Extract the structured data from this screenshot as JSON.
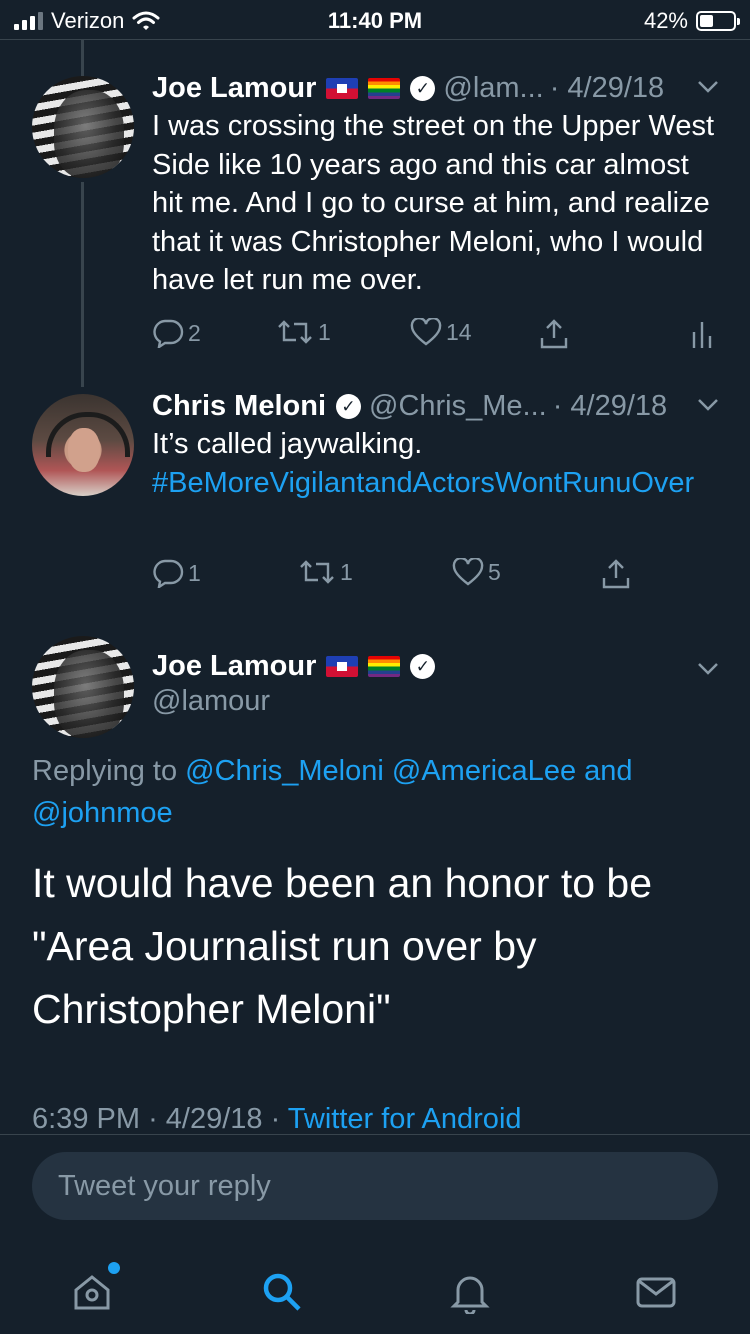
{
  "status_bar": {
    "carrier": "Verizon",
    "time": "11:40 PM",
    "battery_percent": "42%",
    "battery_level": 0.42,
    "signal_bars_on": 3,
    "signal_bars_total": 4
  },
  "tweet1": {
    "name": "Joe Lamour",
    "handle": "@lam...",
    "date": "· 4/29/18",
    "text": "I was crossing the street on the Upper West Side like 10 years ago and this car almost hit me. And I go to curse at him, and realize that it was Christopher Meloni, who I would have let run me over.",
    "replies": "2",
    "retweets": "1",
    "likes": "14"
  },
  "tweet2": {
    "name": "Chris Meloni",
    "handle": "@Chris_Me...",
    "date": "· 4/29/18",
    "text": "It’s called jaywalking.",
    "hashtag": "#BeMoreVigilantandActorsWontRunuOver",
    "replies": "1",
    "retweets": "1",
    "likes": "5"
  },
  "main_tweet": {
    "name": "Joe Lamour",
    "handle": "@lamour",
    "replying_prefix": "Replying to",
    "reply_mention_1": "@Chris_Meloni",
    "reply_mention_2": "@AmericaLee",
    "reply_and": "and",
    "reply_mention_3": "@johnmoe",
    "text": "It would have been an honor to be \"Area Journalist run over by Christopher Meloni\"",
    "time": "6:39 PM",
    "date": "· 4/29/18 ·",
    "source": "Twitter for Android"
  },
  "reply_box": {
    "placeholder": "Tweet your reply"
  },
  "tabbar": {
    "tabs": [
      "home-icon",
      "search-icon",
      "notifications-icon",
      "messages-icon"
    ],
    "active_tab": "search-icon",
    "accent_color": "#1da1f2"
  },
  "colors": {
    "background": "#15202b",
    "secondary_text": "#8899a6",
    "link": "#1da1f2"
  }
}
